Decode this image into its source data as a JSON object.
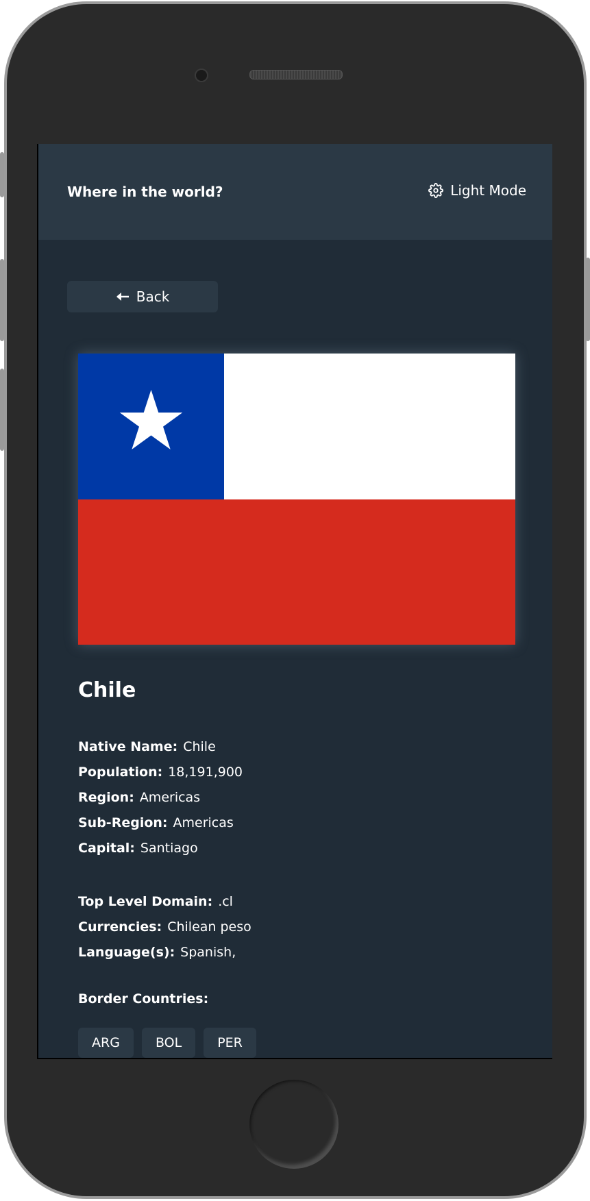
{
  "header": {
    "title": "Where in the world?",
    "mode_label": "Light Mode",
    "mode_icon": "gear-icon"
  },
  "back_button": {
    "label": "Back",
    "icon": "arrow-left-icon"
  },
  "country": {
    "name": "Chile",
    "flag": {
      "colors": {
        "blue": "#0039a6",
        "white": "#ffffff",
        "red": "#d52b1e"
      }
    },
    "primary_info": [
      {
        "key": "Native Name:",
        "value": "Chile"
      },
      {
        "key": "Population:",
        "value": "18,191,900"
      },
      {
        "key": "Region:",
        "value": "Americas"
      },
      {
        "key": "Sub-Region:",
        "value": "Americas"
      },
      {
        "key": "Capital:",
        "value": "Santiago"
      }
    ],
    "secondary_info": [
      {
        "key": "Top Level Domain:",
        "value": ".cl"
      },
      {
        "key": "Currencies:",
        "value": "Chilean peso"
      },
      {
        "key": "Language(s):",
        "value": "Spanish,"
      }
    ],
    "border_label": "Border Countries:",
    "borders": [
      "ARG",
      "BOL",
      "PER"
    ]
  },
  "colors": {
    "background": "#202c37",
    "elements": "#2b3945",
    "text": "#ffffff"
  }
}
